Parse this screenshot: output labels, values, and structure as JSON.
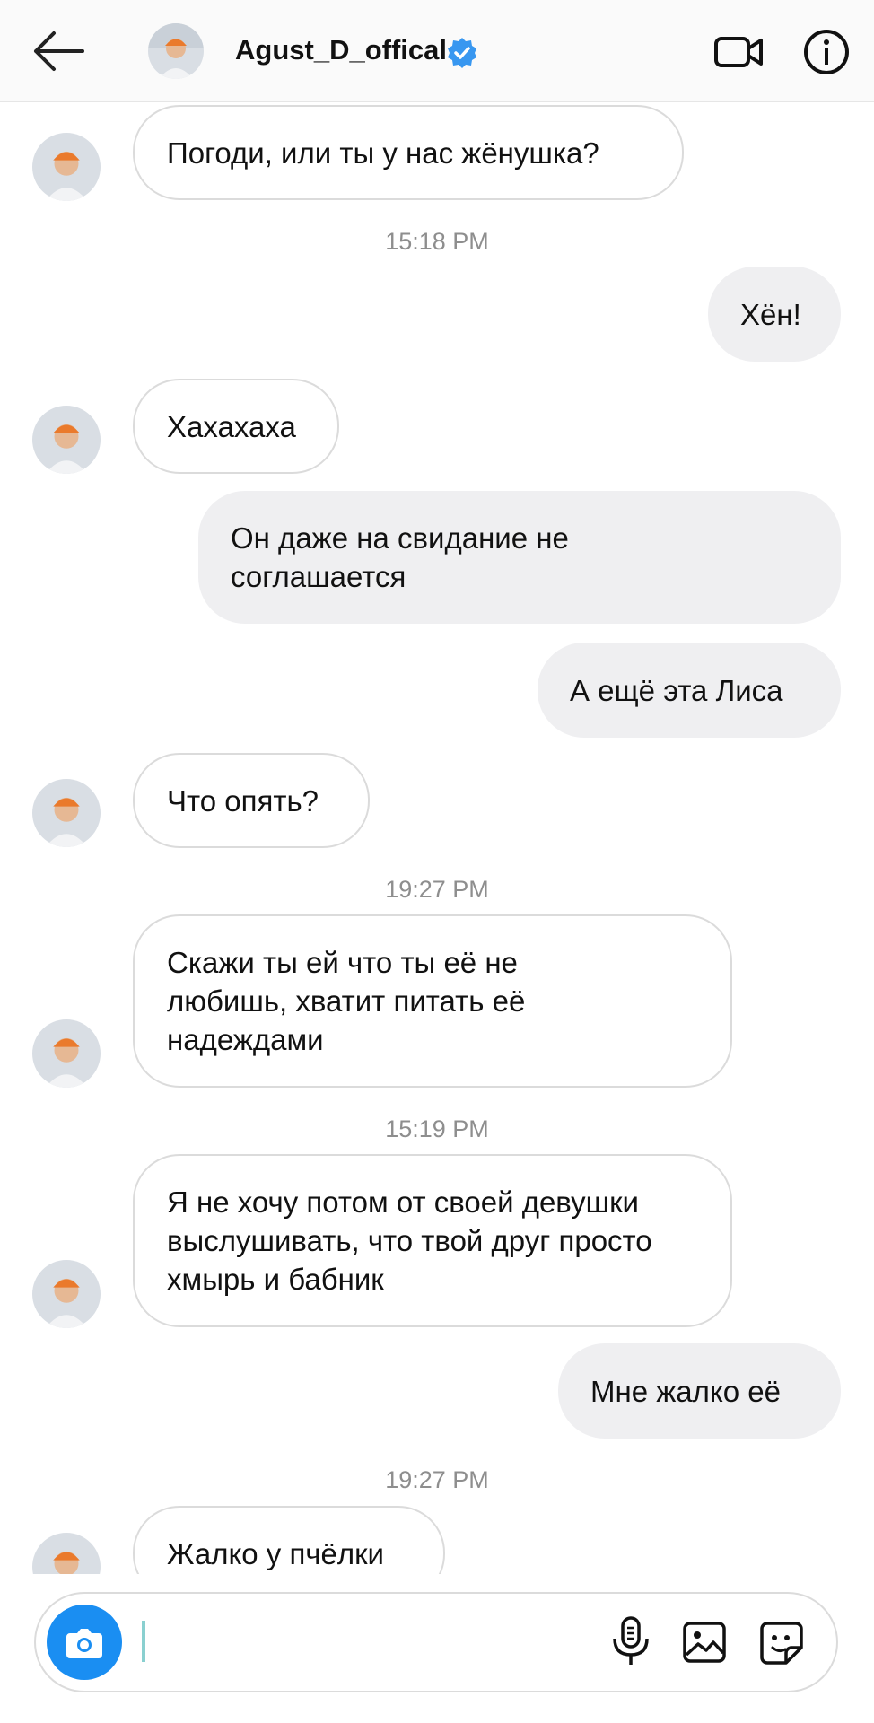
{
  "header": {
    "username": "Agust_D_offical",
    "icons": {
      "back": "arrow-left-icon",
      "verified": "verified-badge-icon",
      "video": "video-camera-icon",
      "info": "info-icon"
    },
    "accent": "#3897f0"
  },
  "messages": [
    {
      "id": "m1",
      "dir": "in",
      "text": "Погоди, или ты у нас жёнушка?"
    },
    {
      "id": "t1",
      "kind": "timestamp",
      "text": "15:18 PM"
    },
    {
      "id": "m2",
      "dir": "out",
      "text": "Хён!"
    },
    {
      "id": "m3",
      "dir": "in",
      "text": "Хахахаха"
    },
    {
      "id": "m4",
      "dir": "out",
      "text": "Он даже на свидание не соглашается"
    },
    {
      "id": "m5",
      "dir": "out",
      "text": "А ещё эта Лиса"
    },
    {
      "id": "m6",
      "dir": "in",
      "text": "Что опять?"
    },
    {
      "id": "t2",
      "kind": "timestamp",
      "text": "19:27 PM"
    },
    {
      "id": "m7",
      "dir": "in",
      "text": "Скажи ты ей что ты её не любишь, хватит питать её надеждами"
    },
    {
      "id": "t3",
      "kind": "timestamp",
      "text": "15:19 PM"
    },
    {
      "id": "m8",
      "dir": "in",
      "text": "Я не хочу потом от своей девушки выслушивать, что твой друг просто хмырь и бабник"
    },
    {
      "id": "m9",
      "dir": "out",
      "text": "Мне жалко её"
    },
    {
      "id": "t4",
      "kind": "timestamp",
      "text": "19:27 PM"
    },
    {
      "id": "m10",
      "dir": "in",
      "text": "Жалко у пчёлки"
    }
  ],
  "composer": {
    "value": "",
    "icons": {
      "camera": "camera-icon",
      "mic": "microphone-icon",
      "gallery": "gallery-icon",
      "sticker": "sticker-icon"
    },
    "camera_color": "#1a8ef2"
  }
}
